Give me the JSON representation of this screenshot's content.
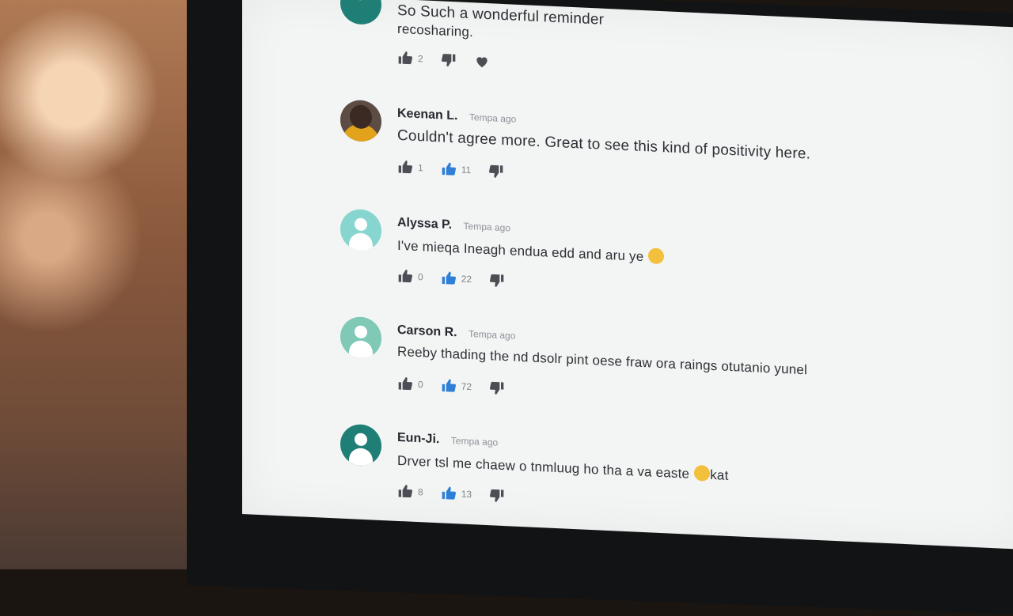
{
  "colors": {
    "like_gray": "#4b4f55",
    "like_blue": "#2f7fd6",
    "avatar_teal_light": "#86d6cf",
    "avatar_teal_mid": "#7fc9b6",
    "avatar_teal_dark": "#1f7f76"
  },
  "comments": [
    {
      "name": "",
      "time": "",
      "text": "So Such a wonderful reminder",
      "text2": "recosharing.",
      "avatar": "leaf-avatar",
      "likes": "2",
      "blue_likes": ""
    },
    {
      "name": "Keenan L.",
      "time": "Tempa ago",
      "text": "Couldn't agree more. Great to see this kind of positivity here.",
      "avatar": "photo-avatar",
      "likes": "1",
      "blue_likes": "11"
    },
    {
      "name": "Alyssa P.",
      "time": "Tempa ago",
      "text": "I've mieqa Ineagh endua edd and aru ye",
      "avatar": "user-avatar",
      "likes": "0",
      "blue_likes": "22"
    },
    {
      "name": "Carson R.",
      "time": "Tempa ago",
      "text": "Reeby thading the nd dsolr pint oese fraw ora raings otutanio yunel",
      "avatar": "user-avatar",
      "likes": "0",
      "blue_likes": "72"
    },
    {
      "name": "Eun-Ji.",
      "time": "Tempa ago",
      "text": "Drver tsl me chaew o tnmluug ho tha a va easte",
      "text_suffix": "kat",
      "avatar": "user-avatar",
      "likes": "8",
      "blue_likes": "13"
    }
  ]
}
